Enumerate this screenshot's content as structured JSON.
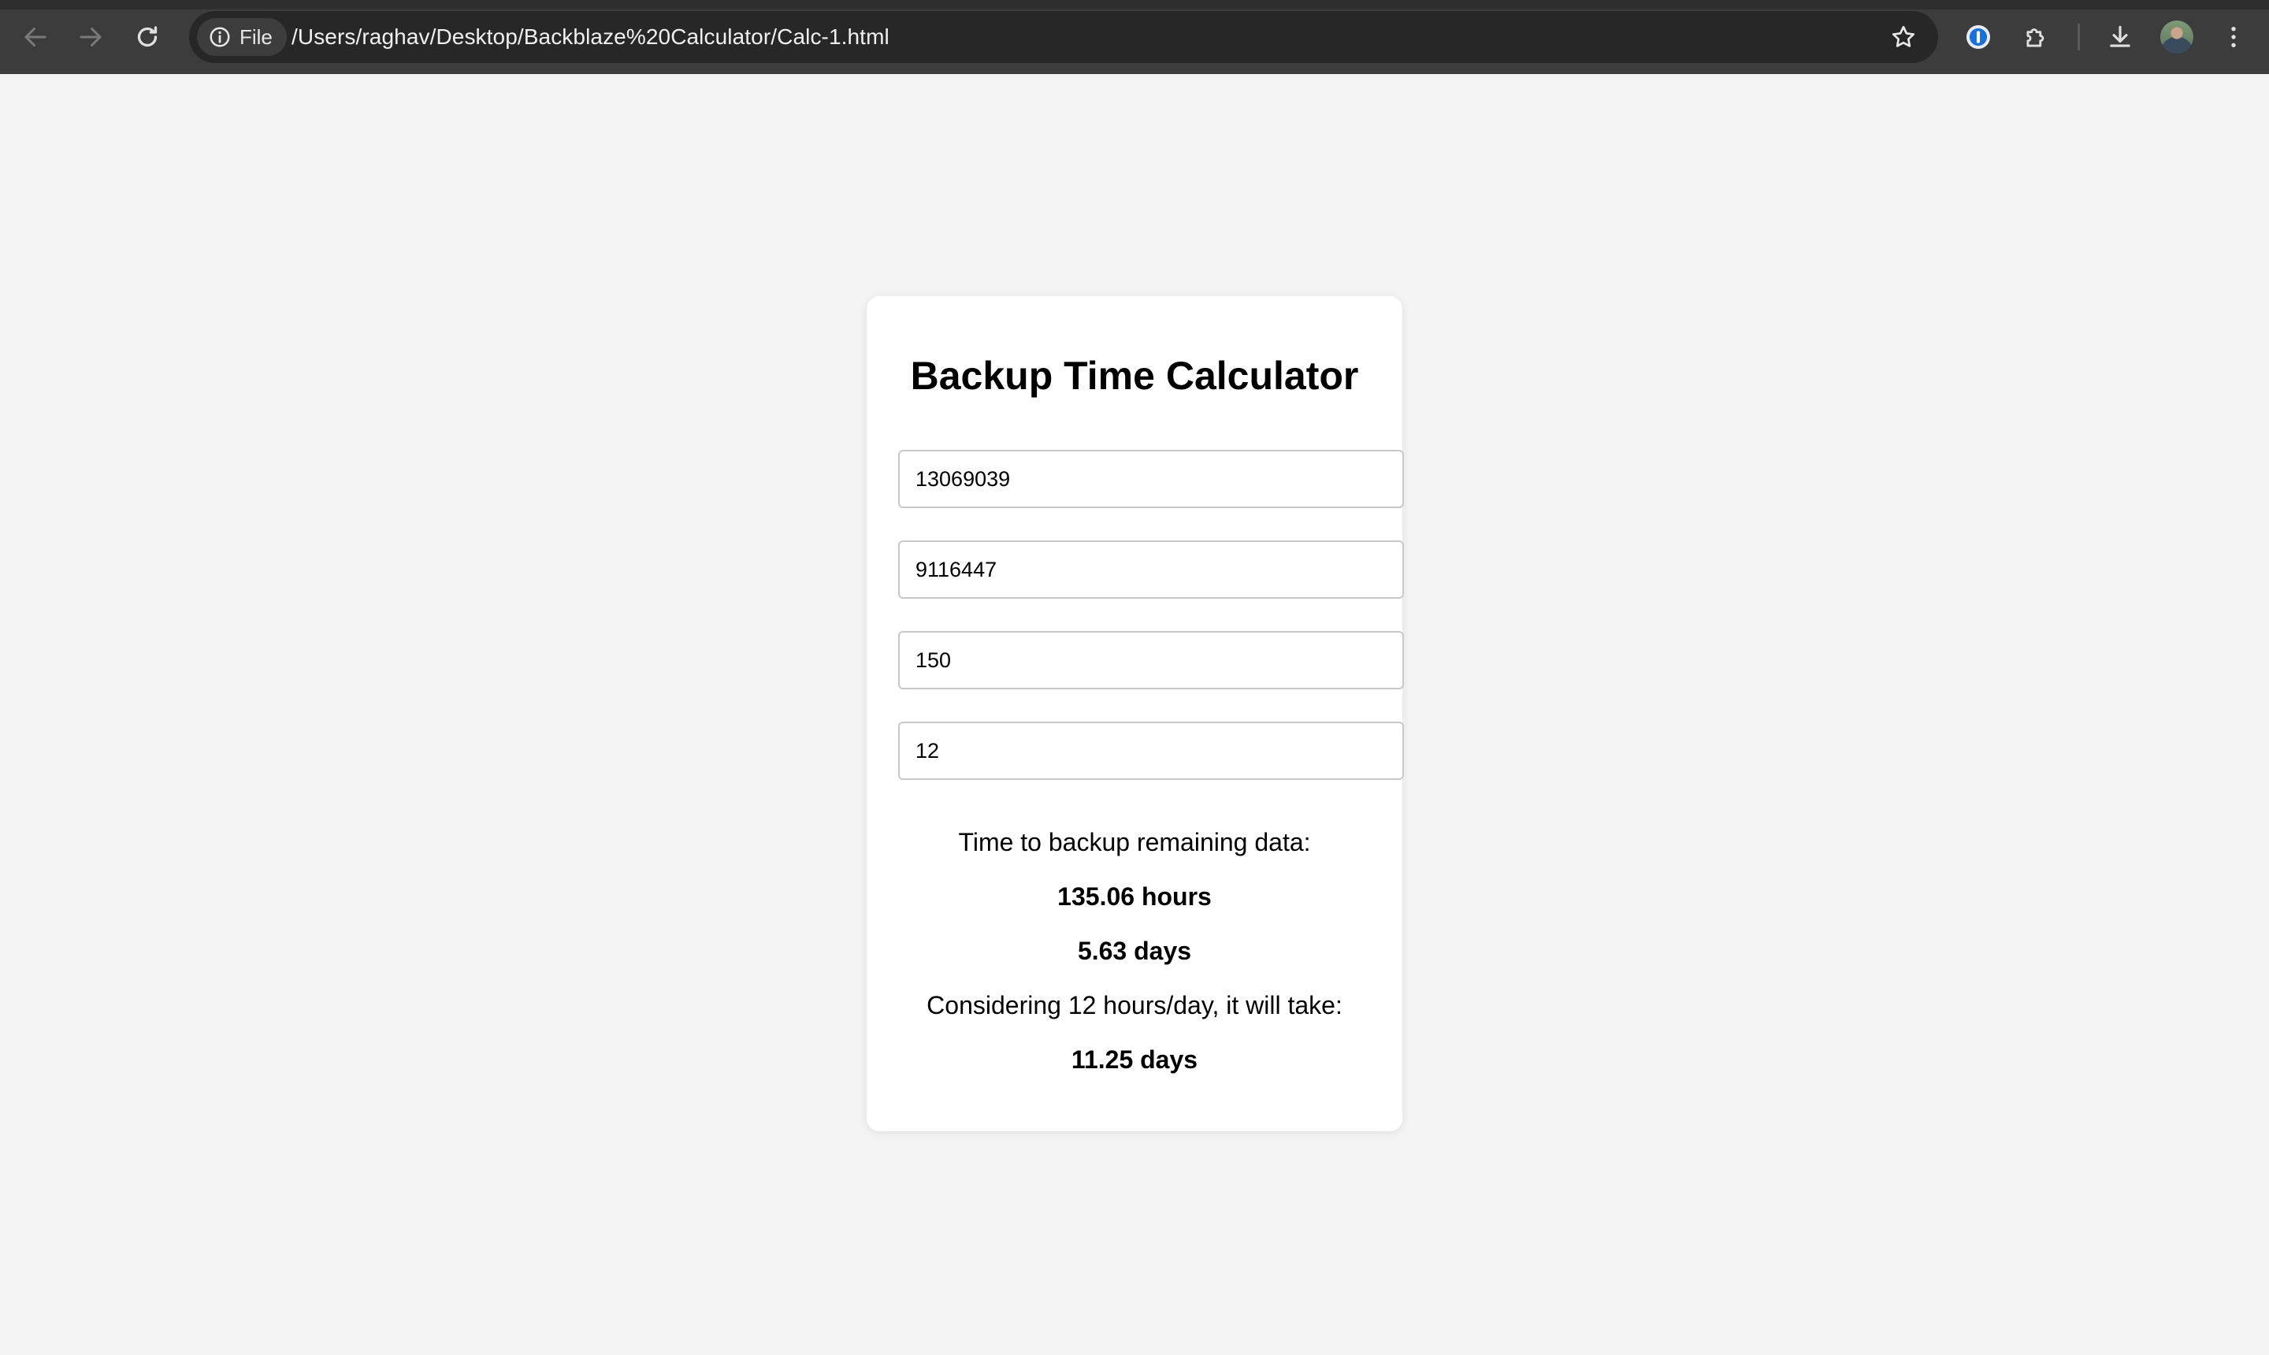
{
  "browser": {
    "site_chip_label": "File",
    "url": "/Users/raghav/Desktop/Backblaze%20Calculator/Calc-1.html"
  },
  "calculator": {
    "title": "Backup Time Calculator",
    "inputs": [
      {
        "value": "13069039"
      },
      {
        "value": "9116447"
      },
      {
        "value": "150"
      },
      {
        "value": "12"
      }
    ],
    "result_heading": "Time to backup remaining data:",
    "hours_result": "135.06 hours",
    "days_result": "5.63 days",
    "schedule_heading": "Considering 12 hours/day, it will take:",
    "schedule_result": "11.25 days"
  },
  "colors": {
    "page_background": "#f3f3f3",
    "card_background": "#ffffff",
    "chrome_background": "#3c3c3c"
  }
}
